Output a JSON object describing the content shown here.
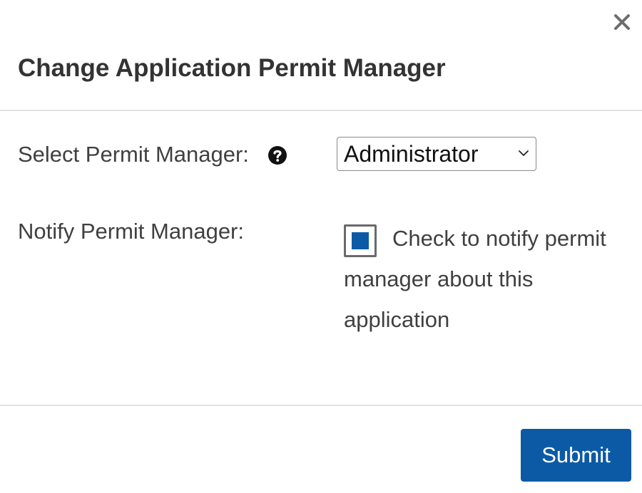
{
  "dialog": {
    "title": "Change Application Permit Manager",
    "close_icon": "close-icon"
  },
  "form": {
    "manager_label": "Select Permit Manager:",
    "help_icon": "question-circle-icon",
    "manager_select": {
      "selected": "Administrator",
      "icon": "chevron-down-icon"
    },
    "notify_label": "Notify Permit Manager:",
    "notify_checkbox": {
      "checked": true,
      "label": "Check to notify permit manager about this application"
    }
  },
  "footer": {
    "submit_label": "Submit"
  },
  "colors": {
    "primary": "#0c5aa6",
    "text": "#404040",
    "title": "#333333",
    "divider": "#e2e2e2"
  }
}
